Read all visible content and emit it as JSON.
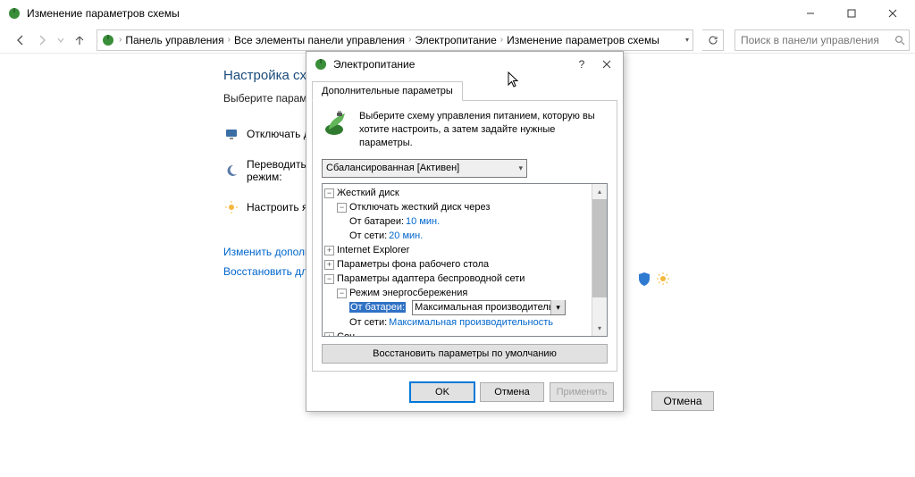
{
  "window": {
    "title": "Изменение параметров схемы"
  },
  "breadcrumb": {
    "items": [
      "Панель управления",
      "Все элементы панели управления",
      "Электропитание",
      "Изменение параметров схемы"
    ]
  },
  "search": {
    "placeholder": "Поиск в панели управления"
  },
  "page": {
    "heading": "Настройка схе",
    "subtitle": "Выберите парам",
    "rows": {
      "display_off": "Отключать ди",
      "sleep": "Переводить к",
      "sleep2": "режим:",
      "brightness": "Настроить яр"
    },
    "links": {
      "advanced": "Изменить дополн",
      "restore": "Восстановить для"
    },
    "cancel": "Отмена"
  },
  "dialog": {
    "title": "Электропитание",
    "tab": "Дополнительные параметры",
    "intro": "Выберите схему управления питанием, которую вы хотите настроить, а затем задайте нужные параметры.",
    "scheme": "Сбалансированная [Активен]",
    "tree": {
      "hdd": "Жесткий диск",
      "hdd_off": "Отключать жесткий диск через",
      "on_battery": "От батареи:",
      "hdd_bat_val": "10 мин.",
      "on_ac": "От сети:",
      "hdd_ac_val": "20 мин.",
      "ie": "Internet Explorer",
      "wallpaper": "Параметры фона рабочего стола",
      "wifi": "Параметры адаптера беспроводной сети",
      "powersave": "Режим энергосбережения",
      "wifi_bat": "От батареи:",
      "wifi_bat_val": "Максимальная производительнос",
      "wifi_ac": "От сети:",
      "wifi_ac_val": "Максимальная производительность",
      "sleep": "Сон"
    },
    "restore_defaults": "Восстановить параметры по умолчанию",
    "ok": "OK",
    "cancel": "Отмена",
    "apply": "Применить"
  }
}
